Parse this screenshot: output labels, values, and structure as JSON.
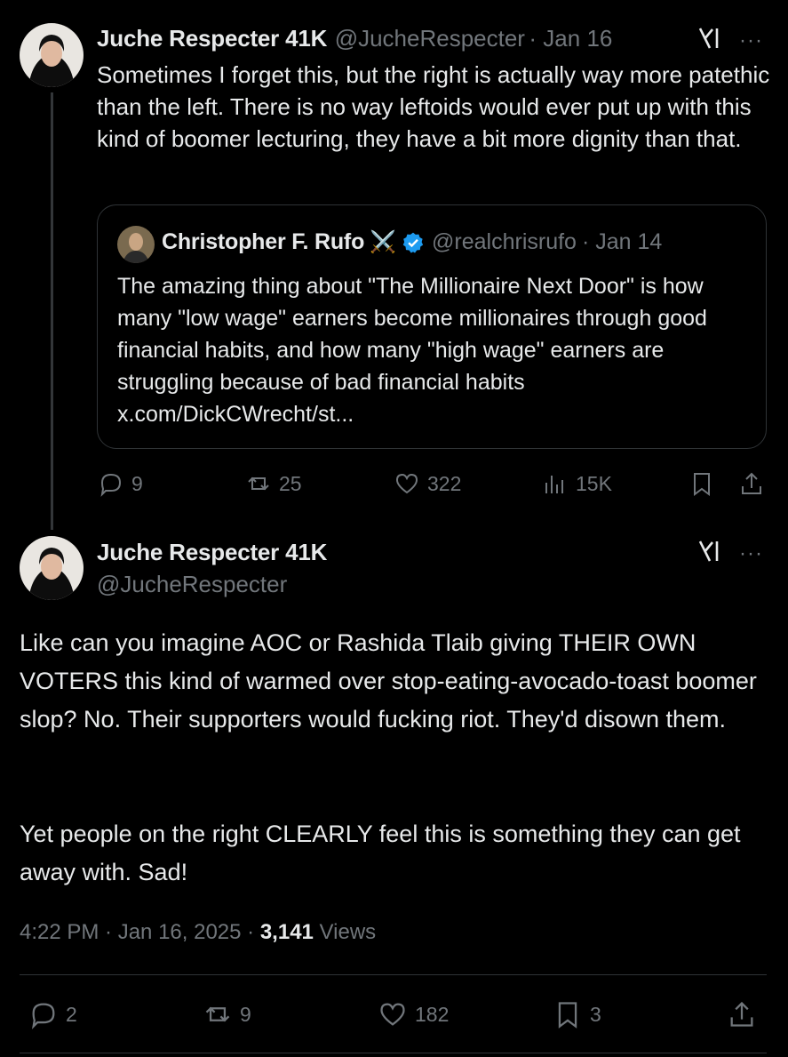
{
  "tweet1": {
    "name": "Juche Respecter 41K",
    "handle": "@JucheRespecter",
    "date": "· Jan 16",
    "text": "Sometimes I forget this, but the right is actually way more patethic than the left. There is no way leftoids would ever put up with this kind of boomer lecturing, they have a bit more dignity than that.",
    "replies": "9",
    "reposts": "25",
    "likes": "322",
    "views": "15K"
  },
  "quote": {
    "name": "Christopher F. Rufo",
    "badge": "⚔️",
    "handle": "@realchrisrufo",
    "date": "· Jan 14",
    "text": "The amazing thing about \"The Millionaire Next Door\" is how many \"low wage\" earners become millionaires through good financial habits, and how many \"high wage\" earners are struggling because of bad financial habits",
    "link": "x.com/DickCWrecht/st..."
  },
  "tweet2": {
    "name": "Juche Respecter 41K",
    "handle": "@JucheRespecter",
    "para1": "Like can you imagine AOC or Rashida Tlaib giving THEIR OWN VOTERS this kind of warmed over stop-eating-avocado-toast boomer slop? No. Their supporters would fucking riot. They'd disown them.",
    "para2": "Yet people on the right CLEARLY feel this is something they can get away with. Sad!",
    "time": "4:22 PM · Jan 16, 2025 · ",
    "views_count": "3,141",
    "views_label": " Views",
    "replies": "2",
    "reposts": "9",
    "likes": "182",
    "bookmarks": "3"
  },
  "colors": {
    "background": "#000000",
    "text": "#e7e9ea",
    "muted": "#71767b",
    "border": "#2f3336",
    "verified": "#1d9bf0"
  }
}
